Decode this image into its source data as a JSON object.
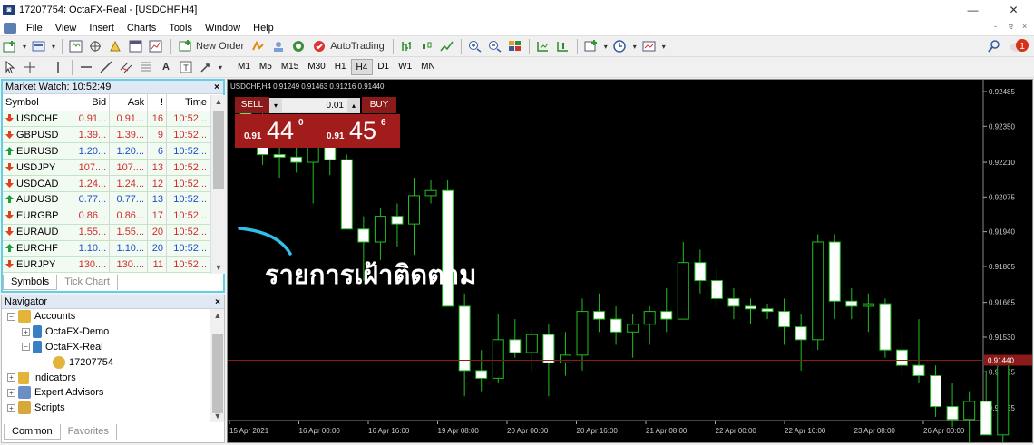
{
  "window": {
    "title": "17207754: OctaFX-Real - [USDCHF,H4]",
    "controls": [
      "—",
      "❐",
      "✕"
    ],
    "mdi": [
      "-",
      "ɐ",
      "×"
    ]
  },
  "menu": [
    "File",
    "View",
    "Insert",
    "Charts",
    "Tools",
    "Window",
    "Help"
  ],
  "toolbar": {
    "new_order": "New Order",
    "auto_trading": "AutoTrading"
  },
  "timeframes": [
    "M1",
    "M5",
    "M15",
    "M30",
    "H1",
    "H4",
    "D1",
    "W1",
    "MN"
  ],
  "active_timeframe": "H4",
  "market_watch": {
    "title": "Market Watch: 10:52:49",
    "columns": [
      "Symbol",
      "Bid",
      "Ask",
      "!",
      "Time"
    ],
    "rows": [
      {
        "symbol": "USDCHF",
        "bid": "0.91...",
        "ask": "0.91...",
        "spread": "16",
        "time": "10:52...",
        "dir": "down"
      },
      {
        "symbol": "GBPUSD",
        "bid": "1.39...",
        "ask": "1.39...",
        "spread": "9",
        "time": "10:52...",
        "dir": "down"
      },
      {
        "symbol": "EURUSD",
        "bid": "1.20...",
        "ask": "1.20...",
        "spread": "6",
        "time": "10:52...",
        "dir": "up"
      },
      {
        "symbol": "USDJPY",
        "bid": "107....",
        "ask": "107....",
        "spread": "13",
        "time": "10:52...",
        "dir": "down"
      },
      {
        "symbol": "USDCAD",
        "bid": "1.24...",
        "ask": "1.24...",
        "spread": "12",
        "time": "10:52...",
        "dir": "down"
      },
      {
        "symbol": "AUDUSD",
        "bid": "0.77...",
        "ask": "0.77...",
        "spread": "13",
        "time": "10:52...",
        "dir": "up"
      },
      {
        "symbol": "EURGBP",
        "bid": "0.86...",
        "ask": "0.86...",
        "spread": "17",
        "time": "10:52...",
        "dir": "down"
      },
      {
        "symbol": "EURAUD",
        "bid": "1.55...",
        "ask": "1.55...",
        "spread": "20",
        "time": "10:52...",
        "dir": "down"
      },
      {
        "symbol": "EURCHF",
        "bid": "1.10...",
        "ask": "1.10...",
        "spread": "20",
        "time": "10:52...",
        "dir": "up"
      },
      {
        "symbol": "EURJPY",
        "bid": "130....",
        "ask": "130....",
        "spread": "11",
        "time": "10:52...",
        "dir": "down"
      }
    ],
    "tabs": [
      "Symbols",
      "Tick Chart"
    ]
  },
  "navigator": {
    "title": "Navigator",
    "items": [
      "Accounts",
      "OctaFX-Demo",
      "OctaFX-Real",
      "17207754",
      "Indicators",
      "Expert Advisors",
      "Scripts"
    ],
    "tabs": [
      "Common",
      "Favorites"
    ]
  },
  "chart": {
    "info": "USDCHF,H4  0.91249 0.91463 0.91216 0.91440",
    "sell_label": "SELL",
    "buy_label": "BUY",
    "lot": "0.01",
    "sell_price": {
      "small": "0.91",
      "big": "44",
      "sup": "0"
    },
    "buy_price": {
      "small": "0.91",
      "big": "45",
      "sup": "6"
    },
    "annotation": "รายการเฝ้าติดตาม"
  },
  "colors": {
    "up_arrow": "#1e9e3e",
    "down_arrow": "#e0401a",
    "bid_red": "#d22b2b",
    "bid_blue": "#1d4fc4",
    "highlight": "#5fd0e6",
    "candle_bull": "#000000",
    "candle_bear": "#ffffff",
    "price_line": "#8b1a1a"
  },
  "chart_data": {
    "type": "candlestick",
    "y_ticks": [
      "0.92485",
      "0.92350",
      "0.92210",
      "0.92075",
      "0.91940",
      "0.91805",
      "0.91665",
      "0.91530",
      "0.91395",
      "0.91255"
    ],
    "current_price": "0.91440",
    "x_ticks": [
      "15 Apr 2021",
      "16 Apr 00:00",
      "16 Apr 16:00",
      "19 Apr 08:00",
      "20 Apr 00:00",
      "20 Apr 16:00",
      "21 Apr 08:00",
      "22 Apr 00:00",
      "22 Apr 16:00",
      "23 Apr 08:00",
      "26 Apr 00:00"
    ],
    "candles": [
      {
        "o": 0.924,
        "h": 0.9245,
        "l": 0.9228,
        "c": 0.9232
      },
      {
        "o": 0.9232,
        "h": 0.924,
        "l": 0.922,
        "c": 0.9224
      },
      {
        "o": 0.9224,
        "h": 0.9232,
        "l": 0.9215,
        "c": 0.9223
      },
      {
        "o": 0.9223,
        "h": 0.923,
        "l": 0.9217,
        "c": 0.9221
      },
      {
        "o": 0.9221,
        "h": 0.9228,
        "l": 0.9205,
        "c": 0.9231
      },
      {
        "o": 0.9231,
        "h": 0.9238,
        "l": 0.9216,
        "c": 0.9222
      },
      {
        "o": 0.9222,
        "h": 0.9224,
        "l": 0.92,
        "c": 0.9195
      },
      {
        "o": 0.9195,
        "h": 0.92,
        "l": 0.9175,
        "c": 0.919
      },
      {
        "o": 0.919,
        "h": 0.9203,
        "l": 0.9183,
        "c": 0.92
      },
      {
        "o": 0.92,
        "h": 0.9205,
        "l": 0.9188,
        "c": 0.9197
      },
      {
        "o": 0.9197,
        "h": 0.9215,
        "l": 0.9185,
        "c": 0.9208
      },
      {
        "o": 0.9208,
        "h": 0.9214,
        "l": 0.9205,
        "c": 0.921
      },
      {
        "o": 0.921,
        "h": 0.9214,
        "l": 0.9165,
        "c": 0.9165
      },
      {
        "o": 0.9165,
        "h": 0.917,
        "l": 0.913,
        "c": 0.914
      },
      {
        "o": 0.914,
        "h": 0.9148,
        "l": 0.9132,
        "c": 0.9137
      },
      {
        "o": 0.9137,
        "h": 0.9162,
        "l": 0.9135,
        "c": 0.9152
      },
      {
        "o": 0.9152,
        "h": 0.916,
        "l": 0.9145,
        "c": 0.9147
      },
      {
        "o": 0.9147,
        "h": 0.9156,
        "l": 0.914,
        "c": 0.9154
      },
      {
        "o": 0.9154,
        "h": 0.9158,
        "l": 0.913,
        "c": 0.9143
      },
      {
        "o": 0.9143,
        "h": 0.9155,
        "l": 0.9138,
        "c": 0.9146
      },
      {
        "o": 0.9146,
        "h": 0.9168,
        "l": 0.914,
        "c": 0.9163
      },
      {
        "o": 0.9163,
        "h": 0.917,
        "l": 0.9155,
        "c": 0.916
      },
      {
        "o": 0.916,
        "h": 0.9165,
        "l": 0.915,
        "c": 0.9155
      },
      {
        "o": 0.9155,
        "h": 0.9162,
        "l": 0.9145,
        "c": 0.9158
      },
      {
        "o": 0.9158,
        "h": 0.9165,
        "l": 0.915,
        "c": 0.9163
      },
      {
        "o": 0.9163,
        "h": 0.9172,
        "l": 0.9155,
        "c": 0.916
      },
      {
        "o": 0.916,
        "h": 0.919,
        "l": 0.916,
        "c": 0.9182
      },
      {
        "o": 0.9182,
        "h": 0.9187,
        "l": 0.917,
        "c": 0.9175
      },
      {
        "o": 0.9175,
        "h": 0.918,
        "l": 0.9165,
        "c": 0.9168
      },
      {
        "o": 0.9168,
        "h": 0.9172,
        "l": 0.916,
        "c": 0.9165
      },
      {
        "o": 0.9165,
        "h": 0.9168,
        "l": 0.9158,
        "c": 0.9164
      },
      {
        "o": 0.9164,
        "h": 0.9166,
        "l": 0.916,
        "c": 0.9163
      },
      {
        "o": 0.9163,
        "h": 0.9168,
        "l": 0.915,
        "c": 0.9157
      },
      {
        "o": 0.9157,
        "h": 0.9162,
        "l": 0.914,
        "c": 0.9152
      },
      {
        "o": 0.9152,
        "h": 0.9193,
        "l": 0.9148,
        "c": 0.919
      },
      {
        "o": 0.919,
        "h": 0.9193,
        "l": 0.916,
        "c": 0.9167
      },
      {
        "o": 0.9167,
        "h": 0.9172,
        "l": 0.916,
        "c": 0.9165
      },
      {
        "o": 0.9165,
        "h": 0.917,
        "l": 0.9155,
        "c": 0.9166
      },
      {
        "o": 0.9166,
        "h": 0.9168,
        "l": 0.9145,
        "c": 0.9148
      },
      {
        "o": 0.9148,
        "h": 0.9155,
        "l": 0.9138,
        "c": 0.9142
      },
      {
        "o": 0.9142,
        "h": 0.916,
        "l": 0.9135,
        "c": 0.9138
      },
      {
        "o": 0.9138,
        "h": 0.9142,
        "l": 0.9122,
        "c": 0.9126
      },
      {
        "o": 0.9126,
        "h": 0.9135,
        "l": 0.9118,
        "c": 0.9121
      },
      {
        "o": 0.9121,
        "h": 0.9132,
        "l": 0.9112,
        "c": 0.9128
      },
      {
        "o": 0.9128,
        "h": 0.914,
        "l": 0.9115,
        "c": 0.9115
      },
      {
        "o": 0.9115,
        "h": 0.9145,
        "l": 0.911,
        "c": 0.9144
      }
    ]
  }
}
